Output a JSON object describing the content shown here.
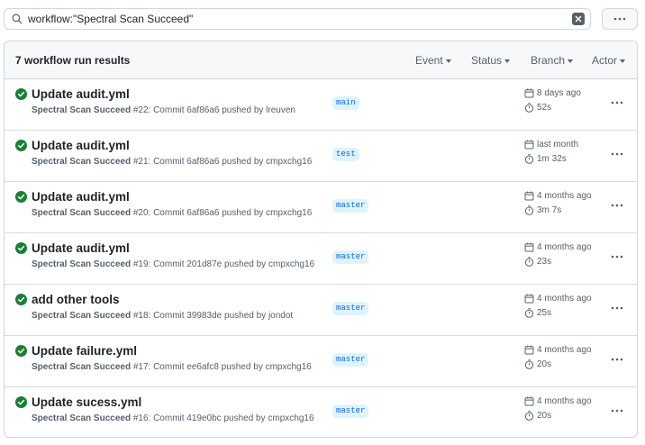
{
  "search": {
    "value": "workflow:\"Spectral Scan Succeed\""
  },
  "header": {
    "results_count": "7 workflow run results",
    "filters": [
      "Event",
      "Status",
      "Branch",
      "Actor"
    ]
  },
  "colors": {
    "success": "#1a7f37",
    "branch_bg": "#ddf4ff",
    "branch_fg": "#0969da"
  },
  "runs": [
    {
      "title": "Update audit.yml",
      "workflow": "Spectral Scan Succeed",
      "meta": "#22: Commit 6af86a6 pushed by lreuven",
      "branch": "main",
      "when": "8 days ago",
      "duration": "52s",
      "status_icon": "check-circle-fill-icon"
    },
    {
      "title": "Update audit.yml",
      "workflow": "Spectral Scan Succeed",
      "meta": "#21: Commit 6af86a6 pushed by cmpxchg16",
      "branch": "test",
      "when": "last month",
      "duration": "1m 32s",
      "status_icon": "check-circle-fill-icon"
    },
    {
      "title": "Update audit.yml",
      "workflow": "Spectral Scan Succeed",
      "meta": "#20: Commit 6af86a6 pushed by cmpxchg16",
      "branch": "master",
      "when": "4 months ago",
      "duration": "3m 7s",
      "status_icon": "check-circle-fill-icon"
    },
    {
      "title": "Update audit.yml",
      "workflow": "Spectral Scan Succeed",
      "meta": "#19: Commit 201d87e pushed by cmpxchg16",
      "branch": "master",
      "when": "4 months ago",
      "duration": "23s",
      "status_icon": "check-circle-fill-icon"
    },
    {
      "title": "add other tools",
      "workflow": "Spectral Scan Succeed",
      "meta": "#18: Commit 39983de pushed by jondot",
      "branch": "master",
      "when": "4 months ago",
      "duration": "25s",
      "status_icon": "check-circle-fill-icon"
    },
    {
      "title": "Update failure.yml",
      "workflow": "Spectral Scan Succeed",
      "meta": "#17: Commit ee6afc8 pushed by cmpxchg16",
      "branch": "master",
      "when": "4 months ago",
      "duration": "20s",
      "status_icon": "check-circle-fill-icon"
    },
    {
      "title": "Update sucess.yml",
      "workflow": "Spectral Scan Succeed",
      "meta": "#16: Commit 419e0bc pushed by cmpxchg16",
      "branch": "master",
      "when": "4 months ago",
      "duration": "20s",
      "status_icon": "check-circle-fill-icon"
    }
  ]
}
